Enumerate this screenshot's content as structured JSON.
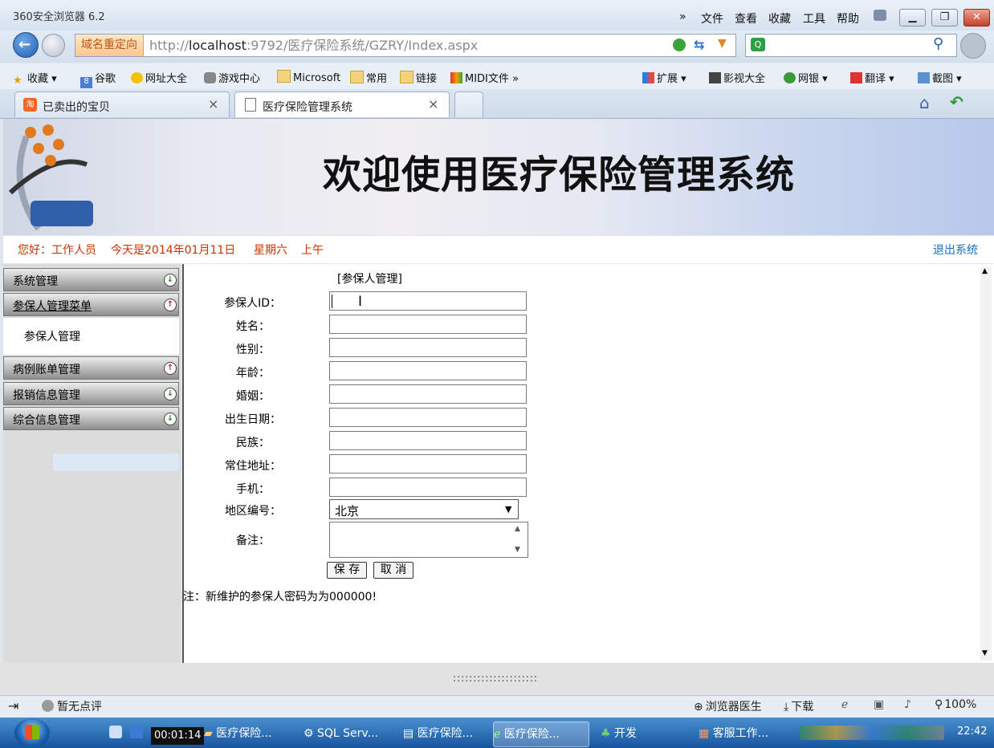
{
  "window": {
    "title": "360安全浏览器 6.2",
    "menu": [
      "文件",
      "查看",
      "收藏",
      "工具",
      "帮助"
    ],
    "expand_glyph": "»"
  },
  "address": {
    "redirect_tag": "域名重定向",
    "url_prefix": "http://",
    "url_host": "localhost",
    "url_rest": ":9792/医疗保险系统/GZRY/Index.aspx"
  },
  "bookmarks": [
    "收藏",
    "谷歌",
    "网址大全",
    "游戏中心",
    "Microsoft",
    "常用",
    "链接",
    "MIDI文件"
  ],
  "bookmarks_right": [
    "扩展",
    "影视大全",
    "网银",
    "翻译",
    "截图"
  ],
  "tabs": [
    {
      "label": "已卖出的宝贝"
    },
    {
      "label": "医疗保险管理系统"
    }
  ],
  "banner": {
    "title": "欢迎使用医疗保险管理系统"
  },
  "status": {
    "greeting": "您好：工作人员",
    "date": "今天是2014年01月11日",
    "weekday": "星期六",
    "period": "上午",
    "logout": "退出系统"
  },
  "sidebar": {
    "items": [
      {
        "label": "系统管理"
      },
      {
        "label": "参保人管理菜单"
      },
      {
        "label": "病例账单管理"
      },
      {
        "label": "报销信息管理"
      },
      {
        "label": "综合信息管理"
      }
    ],
    "submenu": "参保人管理"
  },
  "form": {
    "title": "[参保人管理]",
    "fields": [
      {
        "label": "参保人ID：",
        "value": ""
      },
      {
        "label": "姓名：",
        "value": ""
      },
      {
        "label": "性别：",
        "value": ""
      },
      {
        "label": "年龄：",
        "value": ""
      },
      {
        "label": "婚姻：",
        "value": ""
      },
      {
        "label": "出生日期：",
        "value": ""
      },
      {
        "label": "民族：",
        "value": ""
      },
      {
        "label": "常住地址：",
        "value": ""
      },
      {
        "label": "手机：",
        "value": ""
      }
    ],
    "region_label": "地区编号：",
    "region_value": "北京",
    "remark_label": "备注：",
    "save": "保 存",
    "cancel": "取 消",
    "note": "注：新维护的参保人密码为为000000!"
  },
  "browser_status": {
    "review": "暂无点评",
    "doctor": "浏览器医生",
    "download": "下载",
    "zoom": "100%"
  },
  "taskbar": {
    "timer": "00:01:14",
    "items": [
      "医疗保险...",
      "SQL Serv...",
      "医疗保险...",
      "医疗保险...",
      "开发",
      "客服工作..."
    ],
    "clock": "22:42"
  },
  "colors": {
    "accent_red": "#cc3300",
    "link_blue": "#1a6fc4"
  }
}
